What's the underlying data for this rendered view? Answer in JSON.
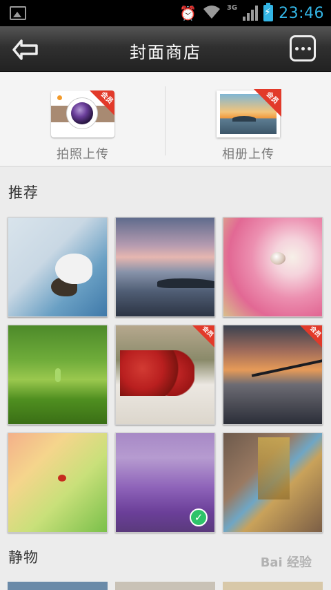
{
  "status_bar": {
    "network": "3G",
    "time": "23:46"
  },
  "header": {
    "title": "封面商店"
  },
  "upload": {
    "camera_label": "拍照上传",
    "album_label": "相册上传",
    "badge": "会员"
  },
  "sections": [
    {
      "title": "推荐"
    },
    {
      "title": "静物"
    }
  ],
  "tiles": [
    {
      "name": "hamster",
      "badge": ""
    },
    {
      "name": "seascape",
      "badge": ""
    },
    {
      "name": "pink-petal-drop",
      "badge": ""
    },
    {
      "name": "green-sprout",
      "badge": ""
    },
    {
      "name": "strawberries",
      "badge": "会员"
    },
    {
      "name": "bridge-sunset",
      "badge": "会员"
    },
    {
      "name": "ladybug",
      "badge": ""
    },
    {
      "name": "lavender",
      "badge": "",
      "selected": true
    },
    {
      "name": "reflection-street",
      "badge": ""
    }
  ],
  "watermark": "Bai 经验"
}
